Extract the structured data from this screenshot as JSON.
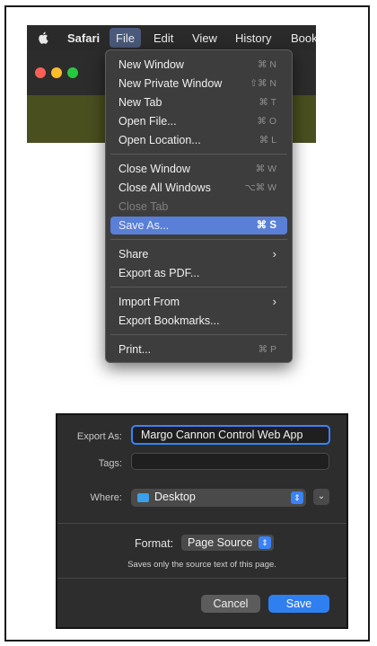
{
  "menubar": {
    "items": [
      "Safari",
      "File",
      "Edit",
      "View",
      "History",
      "Book"
    ],
    "active": "File"
  },
  "file_menu": {
    "items": [
      {
        "label": "New Window",
        "shortcut": "⌘ N"
      },
      {
        "label": "New Private Window",
        "shortcut": "⇧⌘ N"
      },
      {
        "label": "New Tab",
        "shortcut": "⌘ T"
      },
      {
        "label": "Open File...",
        "shortcut": "⌘ O"
      },
      {
        "label": "Open Location...",
        "shortcut": "⌘ L"
      },
      {
        "label": "Close Window",
        "shortcut": "⌘ W"
      },
      {
        "label": "Close All Windows",
        "shortcut": "⌥⌘ W"
      },
      {
        "label": "Close Tab",
        "shortcut": ""
      },
      {
        "label": "Save As...",
        "shortcut": "⌘ S"
      },
      {
        "label": "Share",
        "shortcut": ""
      },
      {
        "label": "Export as PDF...",
        "shortcut": ""
      },
      {
        "label": "Import From",
        "shortcut": ""
      },
      {
        "label": "Export Bookmarks...",
        "shortcut": ""
      },
      {
        "label": "Print...",
        "shortcut": "⌘ P"
      }
    ],
    "highlighted": "Save As...",
    "disabled": [
      "Close Tab"
    ]
  },
  "save_dialog": {
    "export_as_label": "Export As:",
    "export_as_value": "Margo Cannon Control Web App",
    "tags_label": "Tags:",
    "tags_value": "",
    "where_label": "Where:",
    "where_value": "Desktop",
    "format_label": "Format:",
    "format_value": "Page Source",
    "format_note": "Saves only the source text of this page.",
    "cancel_label": "Cancel",
    "save_label": "Save"
  },
  "colors": {
    "accent": "#3b82f6",
    "menu_highlight": "#5a7fd6",
    "save_button": "#2f7ff0",
    "traffic_red": "#ff5f57",
    "traffic_yellow": "#febc2e",
    "traffic_green": "#28c840"
  },
  "icons": [
    "apple-icon",
    "folder-icon",
    "chevron-right-icon",
    "stepper-icon",
    "chevron-down-icon"
  ]
}
